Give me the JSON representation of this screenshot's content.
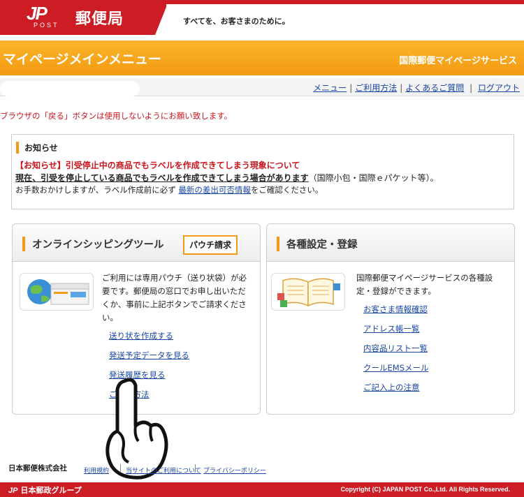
{
  "header": {
    "logo_jp": "JP",
    "logo_post": "POST",
    "brand_name": "郵便局",
    "tagline": "すべてを、お客さまのために。",
    "brand_color": "#cc1d25"
  },
  "title_bar": {
    "page_heading": "マイページメインメニュー",
    "service_name": "国際郵便マイページサービス",
    "accent_color": "#f29a12"
  },
  "nav": {
    "links": [
      "メニュー",
      "ご利用方法",
      "よくあるご質問",
      "ログアウト"
    ]
  },
  "warning": "ブラウザの「戻る」ボタンは使用しないようにお願い致します。",
  "notice": {
    "title": "お知らせ",
    "line1": "【お知らせ】引受停止中の商品でもラベルを作成できてしまう現象について",
    "line2_underlined": "現在、引受を停止している商品でもラベルを作成できてしまう場合があります",
    "line2_rest": "（国際小包・国際ｅパケット等）。",
    "line3_prefix": "お手数おかけしますが、ラベル作成前に必ず",
    "line3_link": "最新の差出可否情報",
    "line3_suffix": "をご確認ください。"
  },
  "shipping_panel": {
    "title": "オンラインシッピングツール",
    "pouch_button": "パウチ請求",
    "description": "ご利用には専用パウチ（送り状袋）が必要です。郵便局の窓口でお申し出いただくか、事前に上記ボタンでご請求ください。",
    "links": [
      "送り状を作成する",
      "発送予定データを見る",
      "発送履歴を見る",
      "ご利用方法"
    ]
  },
  "settings_panel": {
    "title": "各種設定・登録",
    "description": "国際郵便マイページサービスの各種設定・登録ができます。",
    "links": [
      "お客さま情報確認",
      "アドレス帳一覧",
      "内容品リスト一覧",
      "クールEMSメール",
      "ご記入上の注意"
    ]
  },
  "footer": {
    "corp_name": "日本郵便株式会社",
    "links": [
      "利用規約",
      "当サイトのご利用について",
      "プライバシーポリシー"
    ],
    "group_name": "日本郵政グループ",
    "group_logo": "JP",
    "copyright": "Copyright (C) JAPAN POST Co.,Ltd.  All Rights Reserved."
  }
}
